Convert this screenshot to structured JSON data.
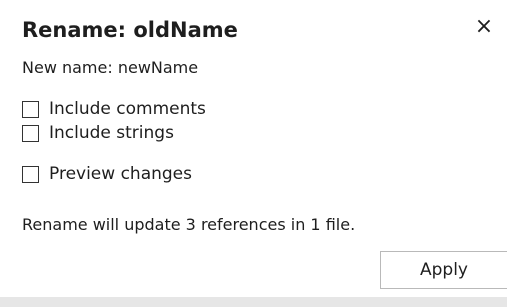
{
  "dialog": {
    "title": "Rename: oldName",
    "close_glyph": "×",
    "close_icon": "close-icon",
    "new_name_text": "New name: newName",
    "options": [
      {
        "label": "Include comments",
        "checked": false
      },
      {
        "label": "Include strings",
        "checked": false
      },
      {
        "label": "Preview changes",
        "checked": false
      }
    ],
    "status_text": "Rename will update 3 references in 1 file.",
    "apply_label": "Apply"
  },
  "colors": {
    "text": "#1e1e1e",
    "background": "#ffffff",
    "button_border": "#b9b9b9",
    "footer_bar": "#e6e6e6"
  }
}
